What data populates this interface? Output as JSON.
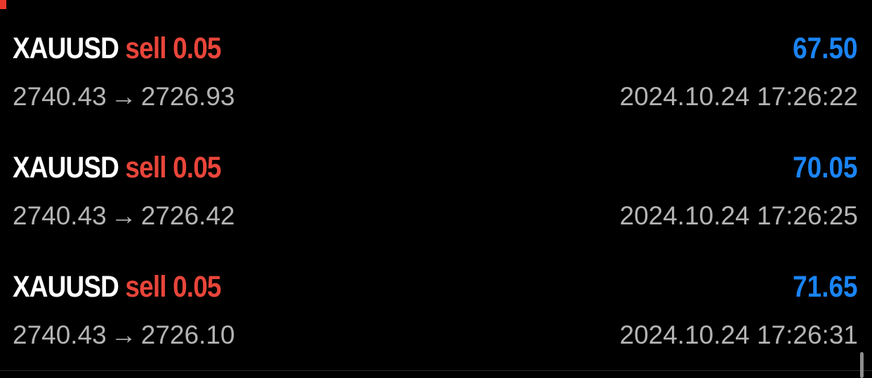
{
  "colors": {
    "background": "#000000",
    "symbol": "#ffffff",
    "sell": "#e8453a",
    "profit": "#1a84f5",
    "secondary_text": "#b4b4b4",
    "marker": "#e8392b"
  },
  "deals": [
    {
      "symbol": "XAUUSD",
      "side": "sell",
      "volume": "0.05",
      "open_price": "2740.43",
      "arrow": "→",
      "close_price": "2726.93",
      "profit": "67.50",
      "time": "2024.10.24 17:26:22"
    },
    {
      "symbol": "XAUUSD",
      "side": "sell",
      "volume": "0.05",
      "open_price": "2740.43",
      "arrow": "→",
      "close_price": "2726.42",
      "profit": "70.05",
      "time": "2024.10.24 17:26:25"
    },
    {
      "symbol": "XAUUSD",
      "side": "sell",
      "volume": "0.05",
      "open_price": "2740.43",
      "arrow": "→",
      "close_price": "2726.10",
      "profit": "71.65",
      "time": "2024.10.24 17:26:31"
    }
  ]
}
